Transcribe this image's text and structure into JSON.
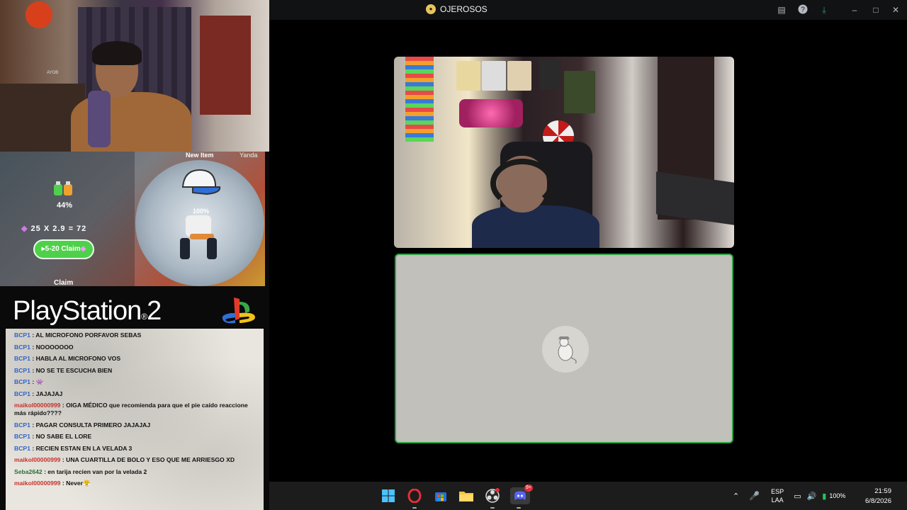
{
  "window": {
    "title": "OJEROSOS"
  },
  "overlay": {
    "webcam_tag": "AYOB",
    "game": {
      "new_item_label": "New Item",
      "item_percent": "100%",
      "progress_percent": "44%",
      "gem_formula": "25  X 2.9  =  72",
      "claim_button": "5-20 Claim",
      "claim_label": "Claim",
      "brand_tag": "Yanda"
    },
    "console_logo": "PlayStation",
    "console_logo_num": "2",
    "console_logo_reg": "®"
  },
  "chat": {
    "messages": [
      {
        "user": "BCP1",
        "text": ": AL MICROFONO PORFAVOR SEBAS",
        "color": "#2f63c8"
      },
      {
        "user": "BCP1",
        "text": ": NOOOOOOO",
        "color": "#2f63c8"
      },
      {
        "user": "BCP1",
        "text": ": HABLA AL MICROFONO VOS",
        "color": "#2f63c8"
      },
      {
        "user": "BCP1",
        "text": ": NO SE TE ESCUCHA BIEN",
        "color": "#2f63c8"
      },
      {
        "user": "BCP1",
        "text": ": 👾",
        "color": "#2f63c8"
      },
      {
        "user": "BCP1",
        "text": ": JAJAJAJ",
        "color": "#2f63c8"
      },
      {
        "user": "maikol00000999",
        "text": ": OIGA MÉDICO que recomienda para que el pie caído reaccione más rápido????",
        "color": "#c8302a"
      },
      {
        "user": "BCP1",
        "text": ": PAGAR CONSULTA PRIMERO JAJAJAJ",
        "color": "#2f63c8"
      },
      {
        "user": "BCP1",
        "text": ": NO SABE EL LORE",
        "color": "#2f63c8"
      },
      {
        "user": "BCP1",
        "text": ": RECIEN ESTAN EN LA VELADA 3",
        "color": "#2f63c8"
      },
      {
        "user": "maikol00000999",
        "text": ": UNA CUARTILLA DE BOLO Y ESO QUE ME ARRIESGO XD",
        "color": "#c8302a"
      },
      {
        "user": "Seba2642",
        "text": ": en tarija recien van por la velada 2",
        "color": "#2a6e3a"
      },
      {
        "user": "maikol00000999",
        "text": ": Never😤",
        "color": "#c8302a"
      }
    ]
  },
  "titlebar_icons": [
    "inbox-icon",
    "help-icon",
    "download-icon",
    "minimize-icon",
    "maximize-icon",
    "close-icon"
  ],
  "taskbar": {
    "apps": [
      "windows-start-icon",
      "opera-icon",
      "microsoft-store-icon",
      "file-explorer-icon",
      "obs-icon",
      "discord-icon"
    ],
    "discord_badge": "9+",
    "language_top": "ESP",
    "language_bottom": "LAA",
    "battery": "100%",
    "time": "21:59",
    "date": "6/8/2026"
  },
  "colors": {
    "speaking_border": "#2ea043",
    "discord_bg": "#111214",
    "taskbar_bg": "#1c1c1c"
  }
}
